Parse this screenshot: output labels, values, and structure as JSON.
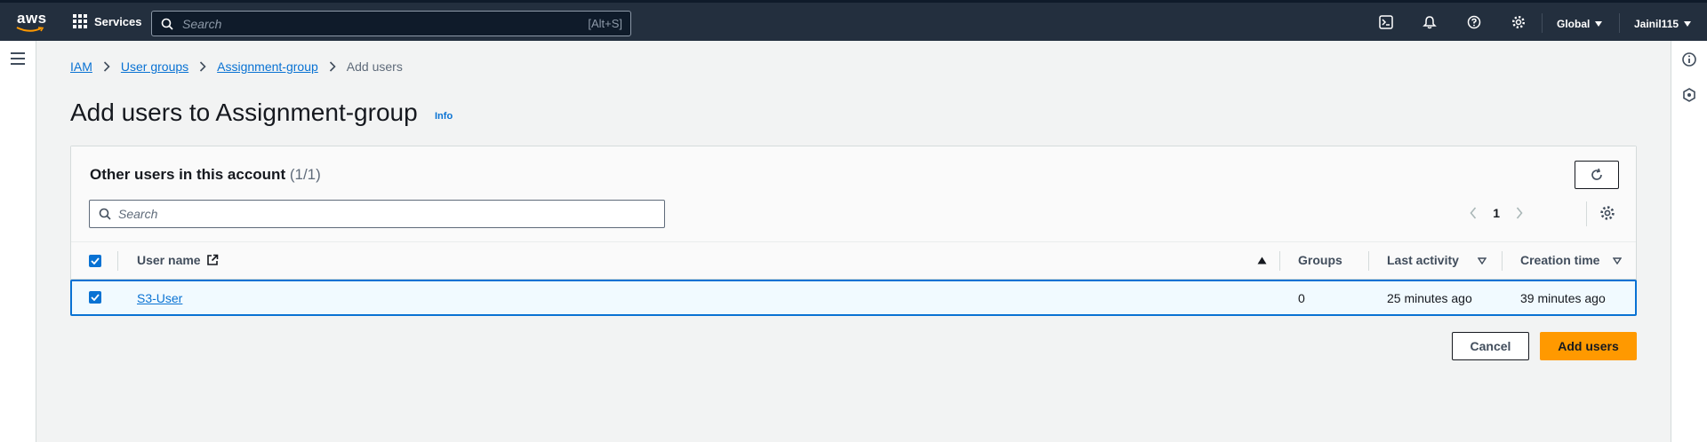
{
  "topnav": {
    "logo_text": "aws",
    "services_label": "Services",
    "search_placeholder": "Search",
    "search_shortcut": "[Alt+S]",
    "region_label": "Global",
    "user_label": "Jainil115"
  },
  "breadcrumb": {
    "items": [
      "IAM",
      "User groups",
      "Assignment-group"
    ],
    "current": "Add users"
  },
  "page": {
    "title": "Add users to Assignment-group",
    "info_link": "Info"
  },
  "panel": {
    "title": "Other users in this account",
    "count": "(1/1)",
    "filter_placeholder": "Search",
    "page_number": "1"
  },
  "table": {
    "columns": [
      "User name",
      "Groups",
      "Last activity",
      "Creation time"
    ],
    "rows": [
      {
        "user_name": "S3-User",
        "groups": "0",
        "last_activity": "25 minutes ago",
        "creation_time": "39 minutes ago",
        "selected": true
      }
    ]
  },
  "actions": {
    "cancel_label": "Cancel",
    "add_label": "Add users"
  },
  "colors": {
    "nav_bg": "#232f3e",
    "link": "#0972d3",
    "primary_button": "#ff9900",
    "selected_row_bg": "#f1faff"
  }
}
